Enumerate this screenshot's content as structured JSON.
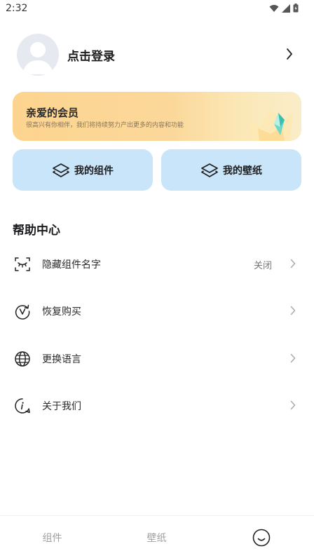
{
  "status_bar": {
    "time": "2:32"
  },
  "profile": {
    "login_label": "点击登录"
  },
  "vip": {
    "title": "亲爱的会员",
    "subtitle": "很高兴有你相伴，我们将持续努力产出更多的内容和功能"
  },
  "quick_actions": {
    "my_widgets": "我的组件",
    "my_wallpapers": "我的壁纸"
  },
  "help": {
    "title": "帮助中心",
    "items": [
      {
        "label": "隐藏组件名字",
        "value": "关闭",
        "icon": "eye-closed-icon"
      },
      {
        "label": "恢复购买",
        "value": "",
        "icon": "restore-icon"
      },
      {
        "label": "更换语言",
        "value": "",
        "icon": "globe-icon"
      },
      {
        "label": "关于我们",
        "value": "",
        "icon": "info-icon"
      }
    ]
  },
  "tab_bar": {
    "tabs": [
      {
        "label": "组件"
      },
      {
        "label": "壁纸"
      },
      {
        "label": "",
        "icon": "smiley-icon"
      }
    ]
  },
  "colors": {
    "card_blue": "#c9e5f9",
    "vip_gold": "#fdd48f",
    "text_dark": "#1c1c1e",
    "tab_inactive": "#a0a0a0"
  }
}
